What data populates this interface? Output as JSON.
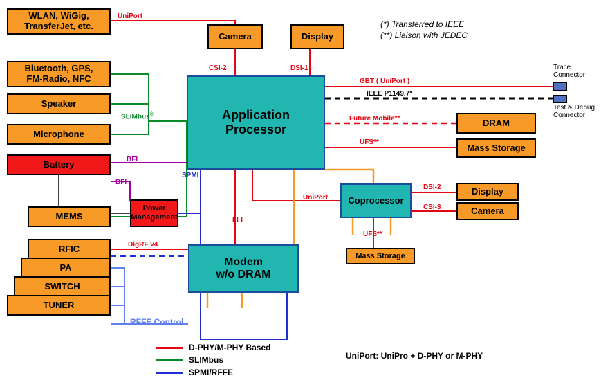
{
  "notes": {
    "ieee": "(*) Transferred to IEEE",
    "jedec": "(**) Liaison with JEDEC"
  },
  "main": {
    "app_proc": "Application\nProcessor",
    "modem": "Modem\nw/o DRAM",
    "coproc": "Coprocessor",
    "pmic": "Power\nManagement"
  },
  "orange": {
    "wlan": "WLAN, WiGig,\nTransferJet, etc.",
    "bt": "Bluetooth, GPS,\nFM-Radio, NFC",
    "speaker": "Speaker",
    "mic": "Microphone",
    "battery": "Battery",
    "mems": "MEMS",
    "rfic": "RFIC",
    "pa": "PA",
    "switch": "SWITCH",
    "tuner": "TUNER",
    "camera": "Camera",
    "display": "Display",
    "dram": "DRAM",
    "mass": "Mass Storage",
    "display2": "Display",
    "camera2": "Camera",
    "mass2": "Mass Storage"
  },
  "labels": {
    "uniport": "UniPort",
    "slimbus": "SLIMbus",
    "slim_r": "®",
    "bfi1": "BFI",
    "bfi2": "BFI",
    "digrf": "DigRF v4",
    "rffe": "RFFE Control",
    "spmi": "SPMI",
    "csi2": "CSI-2",
    "dsi1": "DSI-1",
    "gbt": "GBT ( UniPort )",
    "ieee": "IEEE P1149.7*",
    "future": "Future Mobile**",
    "ufs1": "UFS**",
    "lli": "LLI",
    "uniport2": "UniPort",
    "ufs2": "UFS**",
    "dsi2": "DSI-2",
    "csi3": "CSI-3",
    "trace": "Trace\nConnector",
    "debug": "Test & Debug\nConnector"
  },
  "legend": {
    "dphy": "D-PHY/M-PHY Based",
    "slim": "SLIMbus",
    "spmi": "SPMI/RFFE",
    "uniport": "UniPort: UniPro + D-PHY or M-PHY"
  }
}
